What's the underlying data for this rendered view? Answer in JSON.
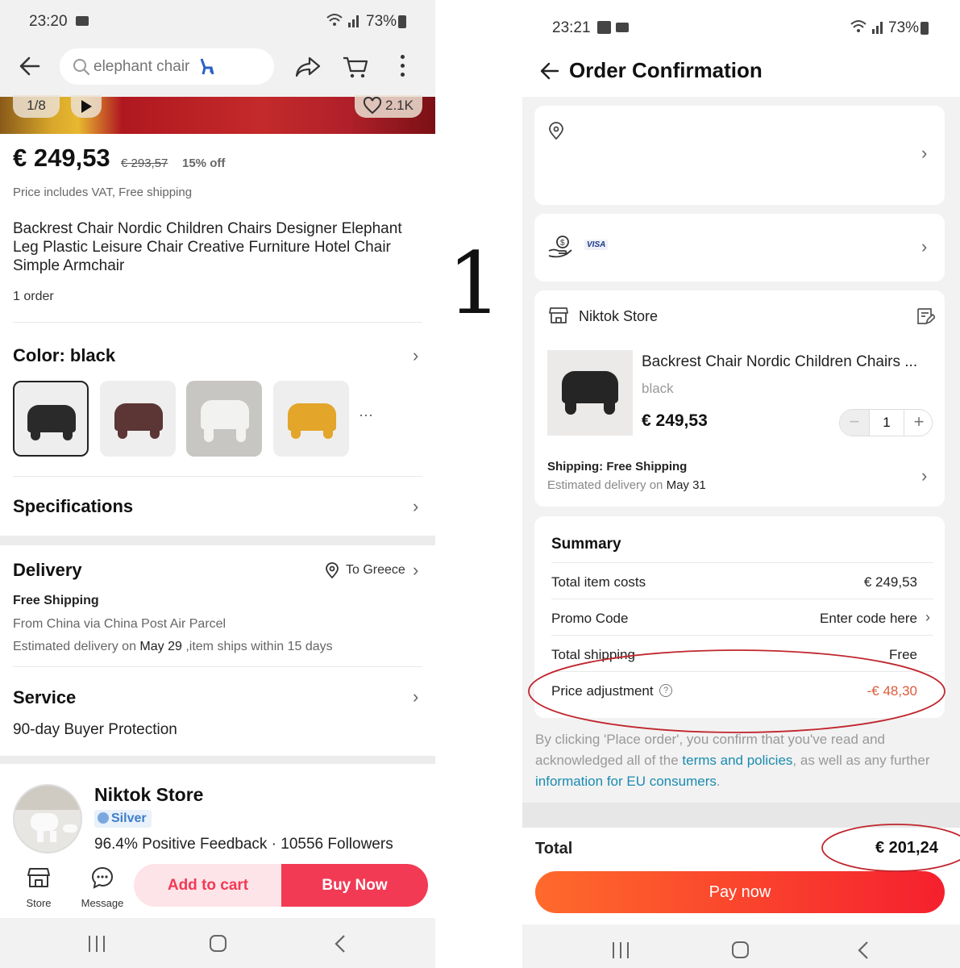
{
  "figure_label": "1",
  "left": {
    "status": {
      "time": "23:20",
      "battery": "73%"
    },
    "search": {
      "placeholder": "elephant chair"
    },
    "gallery": {
      "counter": "1/8",
      "likes": "2.1K"
    },
    "price": {
      "current": "€ 249,53",
      "original": "€ 293,57",
      "discount": "15% off",
      "note": "Price includes VAT, Free shipping"
    },
    "product_title": "Backrest Chair Nordic Children Chairs Designer Elephant Leg Plastic Leisure Chair Creative Furniture Hotel Chair Simple Armchair",
    "orders": "1 order",
    "color": {
      "label": "Color: black",
      "options": [
        "black",
        "brown",
        "white",
        "yellow"
      ],
      "more": "···",
      "selected": "black"
    },
    "specifications": "Specifications",
    "delivery": {
      "title": "Delivery",
      "destination": "To Greece",
      "method": "Free Shipping",
      "route": "From China via China Post Air Parcel",
      "estimate_prefix": "Estimated delivery on ",
      "estimate_date": "May 29",
      "estimate_suffix": " ,item ships within 15 days"
    },
    "service": {
      "title": "Service",
      "detail": "90-day Buyer Protection"
    },
    "store": {
      "name": "Niktok Store",
      "badge": "Silver",
      "stats": "96.4% Positive Feedback · 10556 Followers"
    },
    "bottom": {
      "store": "Store",
      "message": "Message",
      "add_to_cart": "Add to cart",
      "buy_now": "Buy Now"
    }
  },
  "right": {
    "status": {
      "time": "23:21",
      "battery": "73%"
    },
    "title": "Order Confirmation",
    "payment_brand": "VISA",
    "store_name": "Niktok Store",
    "item": {
      "title": "Backrest Chair Nordic Children Chairs ...",
      "variant": "black",
      "price": "€ 249,53",
      "quantity": "1"
    },
    "shipping": {
      "label": "Shipping: Free Shipping",
      "estimate_prefix": "Estimated delivery on ",
      "estimate_date": "May 31"
    },
    "summary": {
      "title": "Summary",
      "rows": [
        {
          "label": "Total item costs",
          "value": "€ 249,53"
        },
        {
          "label": "Promo Code",
          "value": "Enter code here"
        },
        {
          "label": "Total shipping",
          "value": "Free"
        },
        {
          "label": "Price adjustment",
          "value": "-€ 48,30"
        }
      ]
    },
    "legal": {
      "prefix": "By clicking 'Place order', you confirm that you've read and acknowledged all of the ",
      "link1": "terms and policies",
      "middle": ", as well as any further ",
      "link2": "information for EU consumers",
      "suffix": "."
    },
    "total": {
      "label": "Total",
      "value": "€ 201,24"
    },
    "pay_now": "Pay now"
  },
  "colors": {
    "accent": "#f23a55",
    "link": "#1a8bb0",
    "adjust": "#e05a3a",
    "annotation": "#c0262e"
  }
}
